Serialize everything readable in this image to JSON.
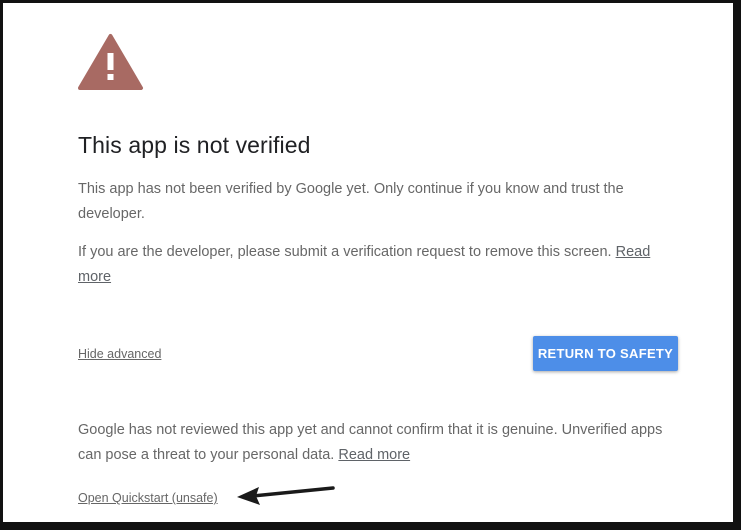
{
  "warning": {
    "icon": "warning-triangle-icon",
    "color": "#a86a63"
  },
  "title": "This app is not verified",
  "paragraph1": "This app has not been verified by Google yet. Only continue if you know and trust the developer.",
  "paragraph2": {
    "text": "If you are the developer, please submit a verification request to remove this screen.",
    "link": "Read more"
  },
  "hide_advanced": "Hide advanced",
  "return_button": {
    "label": "RETURN TO SAFETY",
    "color": "#4d8ee8"
  },
  "paragraph3": {
    "text": "Google has not reviewed this app yet and cannot confirm that it is genuine. Unverified apps can pose a threat to your personal data.",
    "link": "Read more"
  },
  "open_link": "Open Quickstart (unsafe)",
  "annotation": {
    "icon": "arrow-left-icon"
  }
}
